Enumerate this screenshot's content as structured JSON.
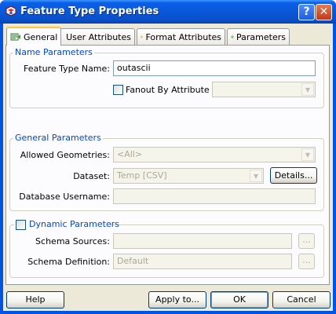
{
  "window": {
    "title": "Feature Type Properties",
    "help_glyph": "?",
    "close_glyph": "✕"
  },
  "tabs": [
    {
      "label": "General",
      "icon": "general-tab-icon"
    },
    {
      "label": "User Attributes",
      "icon": "arrow-diamond-icon"
    },
    {
      "label": "Format Attributes",
      "icon": "arrow-diamond-icon"
    },
    {
      "label": "Parameters",
      "icon": "gear-icon"
    }
  ],
  "name_params": {
    "title": "Name Parameters",
    "feature_type_label": "Feature Type Name:",
    "feature_type_value": "outascii",
    "fanout_label": "Fanout By Attribute",
    "fanout_checked": false,
    "fanout_value": ""
  },
  "general_params": {
    "title": "General Parameters",
    "allowed_geom_label": "Allowed Geometries:",
    "allowed_geom_value": "<All>",
    "dataset_label": "Dataset:",
    "dataset_value": "Temp [CSV]",
    "details_label": "Details...",
    "db_user_label": "Database Username:",
    "db_user_value": ""
  },
  "dynamic_params": {
    "title": "Dynamic Parameters",
    "checked": false,
    "schema_sources_label": "Schema Sources:",
    "schema_sources_value": "",
    "schema_def_label": "Schema Definition:",
    "schema_def_value": "Default",
    "ellipsis": "..."
  },
  "footer": {
    "help": "Help",
    "apply": "Apply to...",
    "ok": "OK",
    "cancel": "Cancel"
  },
  "colors": {
    "titlebar": "#0a58d8",
    "group_title": "#0046d5",
    "tab_accent": "#ffc83c",
    "face": "#ece9d8"
  }
}
